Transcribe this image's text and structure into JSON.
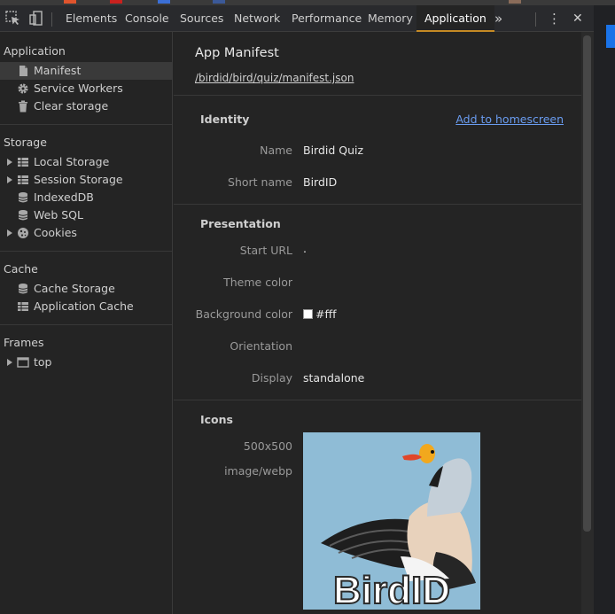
{
  "tabs": [
    {
      "label": "Elements",
      "active": false
    },
    {
      "label": "Console",
      "active": false
    },
    {
      "label": "Sources",
      "active": false
    },
    {
      "label": "Network",
      "active": false
    },
    {
      "label": "Performance",
      "active": false
    },
    {
      "label": "Memory",
      "active": false
    },
    {
      "label": "Application",
      "active": true
    }
  ],
  "toolbar": {
    "more_tabs": "»",
    "menu": "⋮",
    "close": "✕"
  },
  "sidebar": {
    "application": {
      "title": "Application",
      "items": [
        {
          "label": "Manifest",
          "icon": "document-icon"
        },
        {
          "label": "Service Workers",
          "icon": "gear-icon"
        },
        {
          "label": "Clear storage",
          "icon": "trash-icon"
        }
      ]
    },
    "storage": {
      "title": "Storage",
      "items": [
        {
          "label": "Local Storage",
          "icon": "grid-icon"
        },
        {
          "label": "Session Storage",
          "icon": "grid-icon"
        },
        {
          "label": "IndexedDB",
          "icon": "database-icon"
        },
        {
          "label": "Web SQL",
          "icon": "database-icon"
        },
        {
          "label": "Cookies",
          "icon": "cookie-icon"
        }
      ]
    },
    "cache": {
      "title": "Cache",
      "items": [
        {
          "label": "Cache Storage",
          "icon": "database-icon"
        },
        {
          "label": "Application Cache",
          "icon": "grid-icon"
        }
      ]
    },
    "frames": {
      "title": "Frames",
      "items": [
        {
          "label": "top",
          "icon": "frame-icon"
        }
      ]
    }
  },
  "main": {
    "title": "App Manifest",
    "manifest_url": "/birdid/bird/quiz/manifest.json",
    "identity": {
      "title": "Identity",
      "add_to_homescreen": "Add to homescreen",
      "name_label": "Name",
      "name_value": "Birdid Quiz",
      "short_name_label": "Short name",
      "short_name_value": "BirdID"
    },
    "presentation": {
      "title": "Presentation",
      "start_url_label": "Start URL",
      "start_url_value": ".",
      "theme_color_label": "Theme color",
      "background_color_label": "Background color",
      "background_color_value": "#fff",
      "orientation_label": "Orientation",
      "display_label": "Display",
      "display_value": "standalone"
    },
    "icons": {
      "title": "Icons",
      "size": "500x500",
      "type": "image/webp",
      "image_text": "BirdID"
    }
  },
  "colors": {
    "accent": "#c58a24",
    "link": "#6a9cf0",
    "background": "#242424"
  }
}
